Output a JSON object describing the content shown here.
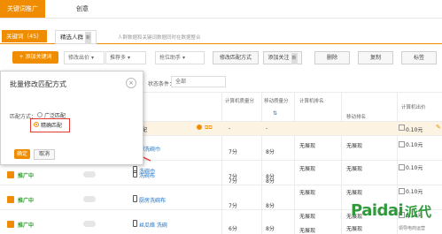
{
  "tabs": [
    {
      "label": "关键词推广"
    },
    {
      "label": "创意"
    }
  ],
  "subtabs": {
    "keywords": "关键词（45）",
    "audience": "精选人群",
    "audience_badge": "新",
    "hint": "人群数据和关键词数据同时在数据整合"
  },
  "toolbar": {
    "add_keyword": "+ 添加关键词",
    "dropdowns": [
      "修改出价",
      "推荐多",
      "抢位助手"
    ],
    "buttons": [
      "修改匹配方式",
      "添加关注",
      "删除",
      "复制",
      "标签"
    ],
    "add_follow_badge": "新"
  },
  "filter": {
    "label": "状态条件：",
    "value": "全部"
  },
  "table": {
    "headers": {
      "calc_rank": "计算机质量分",
      "mobile_rank": "移动质量分",
      "calc_pos": "计算机排名",
      "mobile_pos": "移动排名",
      "calc_price": "计算机出价"
    },
    "first_row": {
      "label": "配",
      "dash1": "-",
      "dash2": "-",
      "price": "0.10元"
    },
    "rows": [
      {
        "status": "",
        "keyword": "脚洗碗巾",
        "q1": "7分",
        "q2": "8分",
        "rank1": "无展现",
        "rank2": "无展现",
        "price": "0.10元"
      },
      {
        "status": "",
        "keyword": "洗碗巾",
        "q1": "7分",
        "q2": "8分",
        "rank1": "无展现",
        "rank2": "无展现",
        "price": "0.10元"
      },
      {
        "status": "推广中",
        "keyword": "洗碗布",
        "q1": "7分",
        "q2": "8分",
        "rank1": "无展现",
        "rank2": "无展现",
        "price": "0.10元"
      },
      {
        "status": "推广中",
        "keyword": "厨房洗碗布",
        "q1": "7分",
        "q2": "8分",
        "rank1": "无展现",
        "rank2": "无展现",
        "price": "0.10元"
      },
      {
        "status": "推广中",
        "keyword": "丝瓜络 洗碗",
        "q1": "6分",
        "q2": "8分",
        "rank1": "无展现",
        "rank2": "无展现",
        "price": "0.10元"
      }
    ]
  },
  "modal": {
    "title": "批量修改匹配方式",
    "close": "×",
    "match_label": "匹配方式：",
    "option_broad": "广泛匹配",
    "option_exact": "精确匹配",
    "confirm": "确定",
    "cancel": "取消"
  },
  "watermark": {
    "latin": "Paidai",
    "cn": "派代",
    "url": "www.paidai.com",
    "sub": "领导电商运营"
  },
  "colors": {
    "accent": "#f08c00",
    "status_green": "#2a9d2a",
    "link_blue": "#1a6fc4",
    "arrow_red": "#e53935"
  }
}
